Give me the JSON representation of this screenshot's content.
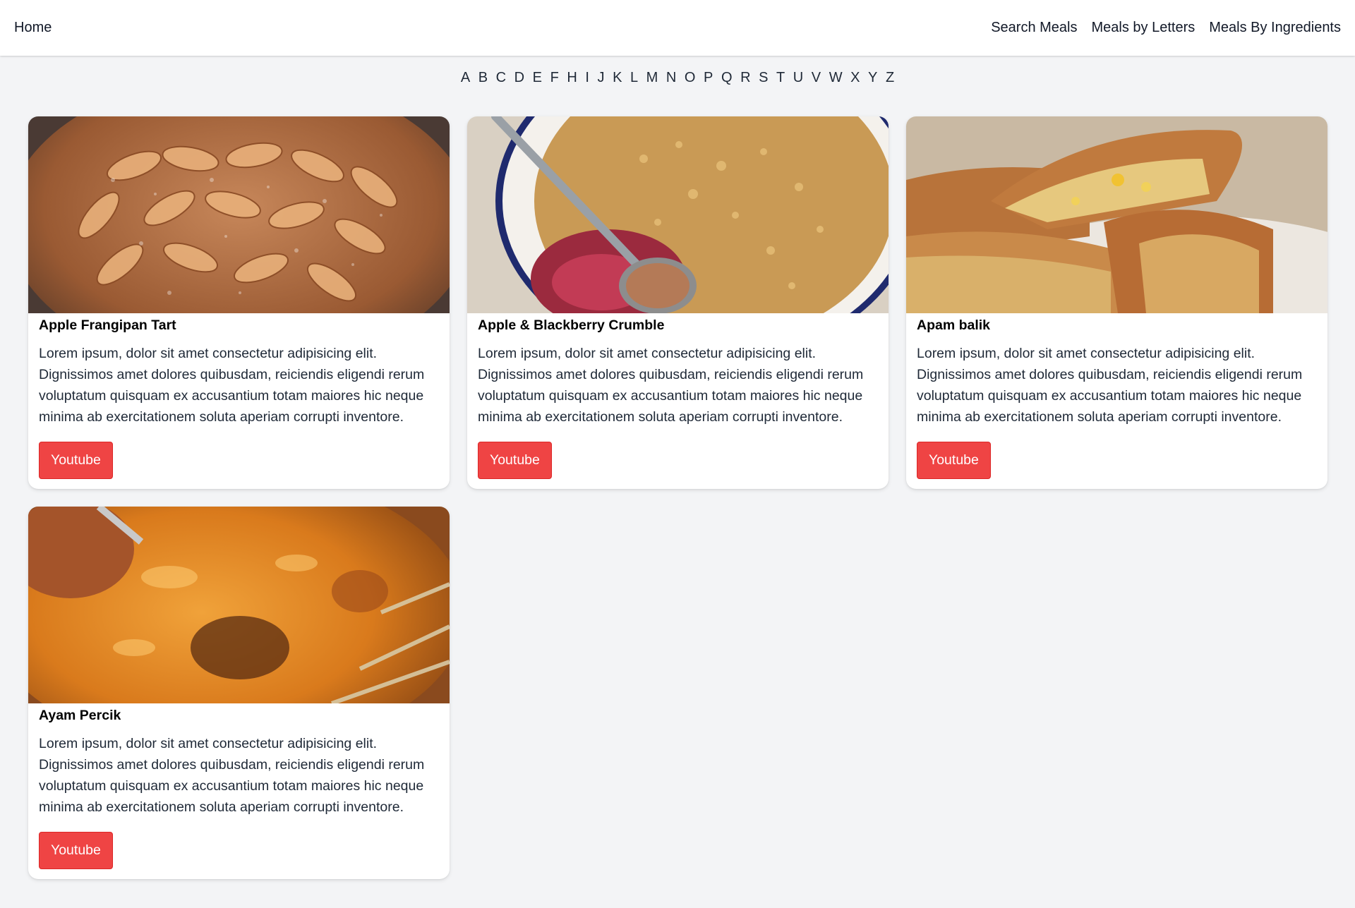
{
  "nav": {
    "home": "Home",
    "search_meals": "Search Meals",
    "meals_by_letters": "Meals by Letters",
    "meals_by_ingredients": "Meals By Ingredients"
  },
  "letters": [
    "A",
    "B",
    "C",
    "D",
    "E",
    "F",
    "H",
    "I",
    "J",
    "K",
    "L",
    "M",
    "N",
    "O",
    "P",
    "Q",
    "R",
    "S",
    "T",
    "U",
    "V",
    "W",
    "X",
    "Y",
    "Z"
  ],
  "meals": [
    {
      "title": "Apple Frangipan Tart",
      "description": "Lorem ipsum, dolor sit amet consectetur adipisicing elit. Dignissimos amet dolores quibusdam, reiciendis eligendi rerum voluptatum quisquam ex accusantium totam maiores hic neque minima ab exercitationem soluta aperiam corrupti inventore.",
      "button": "Youtube",
      "image": "apple-frangipan-tart-photo"
    },
    {
      "title": "Apple & Blackberry Crumble",
      "description": "Lorem ipsum, dolor sit amet consectetur adipisicing elit. Dignissimos amet dolores quibusdam, reiciendis eligendi rerum voluptatum quisquam ex accusantium totam maiores hic neque minima ab exercitationem soluta aperiam corrupti inventore.",
      "button": "Youtube",
      "image": "apple-blackberry-crumble-photo"
    },
    {
      "title": "Apam balik",
      "description": "Lorem ipsum, dolor sit amet consectetur adipisicing elit. Dignissimos amet dolores quibusdam, reiciendis eligendi rerum voluptatum quisquam ex accusantium totam maiores hic neque minima ab exercitationem soluta aperiam corrupti inventore.",
      "button": "Youtube",
      "image": "apam-balik-photo"
    },
    {
      "title": "Ayam Percik",
      "description": "Lorem ipsum, dolor sit amet consectetur adipisicing elit. Dignissimos amet dolores quibusdam, reiciendis eligendi rerum voluptatum quisquam ex accusantium totam maiores hic neque minima ab exercitationem soluta aperiam corrupti inventore.",
      "button": "Youtube",
      "image": "ayam-percik-photo"
    }
  ],
  "colors": {
    "background": "#f3f4f6",
    "button": "#ef4444",
    "card": "#ffffff"
  }
}
